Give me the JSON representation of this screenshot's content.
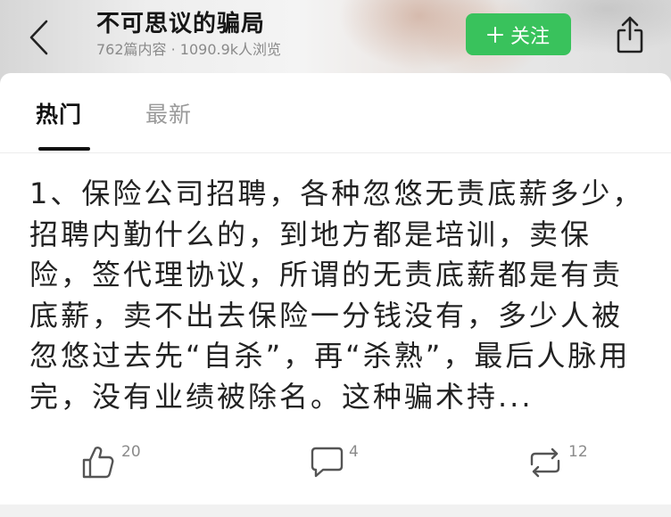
{
  "header": {
    "title": "不可思议的骗局",
    "subtitle": "762篇内容 · 1090.9k人浏览",
    "back_icon": "chevron-left-icon",
    "follow_button": {
      "label": "关注",
      "icon": "plus-icon"
    },
    "share_icon": "share-icon"
  },
  "tabs": [
    {
      "label": "热门",
      "active": true
    },
    {
      "label": "最新",
      "active": false
    }
  ],
  "post": {
    "lines": [
      "1、保险公司招聘，各种忽悠无责底薪多少，",
      "招聘内勤什么的，到地方都是培训，卖保",
      "险，签代理协议，所谓的无责底薪都是有责",
      "底薪，卖不出去保险一分钱没有，多少人被",
      "忽悠过去先“自杀”，再“杀熟”，最后人脉用",
      "完，没有业绩被除名。这种骗术持..."
    ],
    "actions": {
      "like": {
        "icon": "thumbs-up-icon",
        "count": "20"
      },
      "comment": {
        "icon": "comment-icon",
        "count": "4"
      },
      "repost": {
        "icon": "repost-icon",
        "count": "12"
      }
    }
  },
  "colors": {
    "accent": "#39c25c",
    "text": "#222222",
    "muted": "#9a9a9a"
  }
}
